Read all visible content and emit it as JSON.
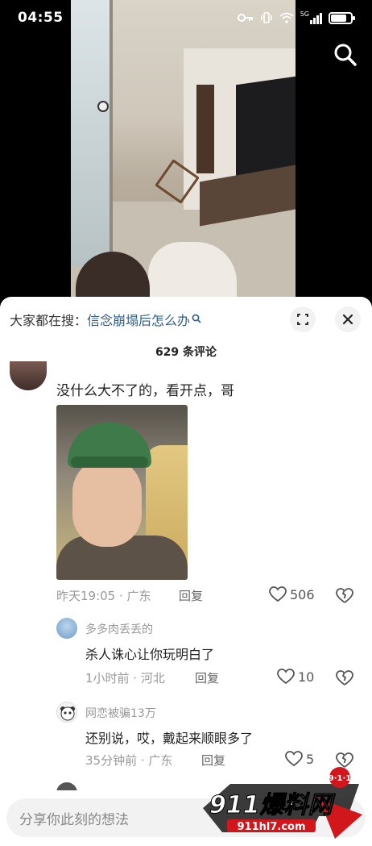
{
  "status_bar": {
    "time": "04:55",
    "network_label": "5G",
    "battery_percent": 80
  },
  "video": {
    "search_icon": "search-icon"
  },
  "sheet": {
    "search_prefix": "大家都在搜：",
    "search_suggestion": "信念崩塌后怎么办",
    "comment_count": "629 条评论"
  },
  "comments": [
    {
      "text": "没什么大不了的，看开点，哥",
      "time": "昨天19:05 · 广东",
      "reply_label": "回复",
      "likes": "506"
    }
  ],
  "replies": [
    {
      "name": "多多肉丢丢的",
      "text": "杀人诛心让你玩明白了",
      "time": "1小时前 · 河北",
      "reply_label": "回复",
      "likes": "10"
    },
    {
      "name": "网恋被骗13万",
      "text": "还别说，哎，戴起来顺眼多了",
      "time": "35分钟前 · 广东",
      "reply_label": "回复",
      "likes": "5"
    }
  ],
  "input": {
    "placeholder": "分享你此刻的想法"
  },
  "watermark": {
    "brand": "911爆料网",
    "badge": "9·1·1",
    "url": "911hl7.com"
  }
}
